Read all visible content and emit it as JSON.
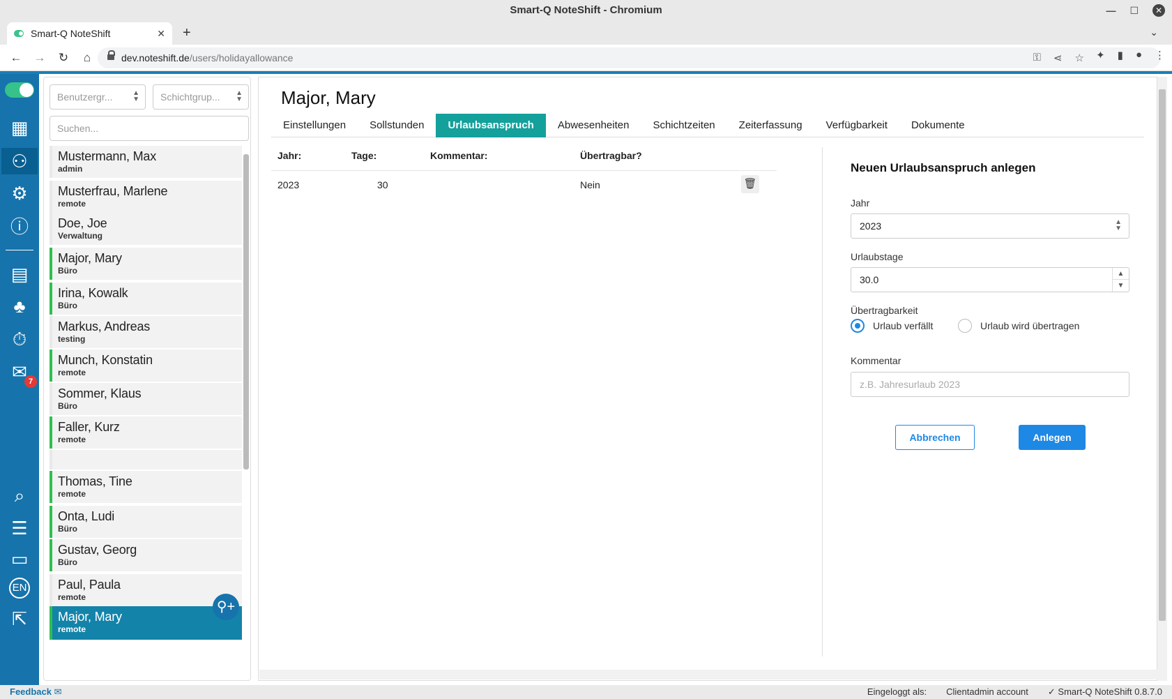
{
  "browser": {
    "window_title": "Smart-Q NoteShift - Chromium",
    "tab_title": "Smart-Q NoteShift",
    "url_host": "dev.noteshift.de",
    "url_path": "/users/holidayallowance"
  },
  "filters": {
    "user_group_placeholder": "Benutzergr...",
    "shift_group_placeholder": "Schichtgrup...",
    "search_placeholder": "Suchen..."
  },
  "users": [
    {
      "name": "Mustermann, Max",
      "group": "admin"
    },
    {
      "name": "Musterfrau, Marlene",
      "group": "remote"
    },
    {
      "name": "Doe, Joe",
      "group": "Verwaltung"
    },
    {
      "name": "Major, Mary",
      "group": "Büro"
    },
    {
      "name": "Irina, Kowalk",
      "group": "Büro"
    },
    {
      "name": "Markus, Andreas",
      "group": "testing"
    },
    {
      "name": "Munch, Konstatin",
      "group": "remote"
    },
    {
      "name": "Sommer, Klaus",
      "group": "Büro"
    },
    {
      "name": "Faller, Kurz",
      "group": "remote"
    },
    {
      "name": "",
      "group": ""
    },
    {
      "name": "Thomas, Tine",
      "group": "remote"
    },
    {
      "name": "Onta, Ludi",
      "group": "Büro"
    },
    {
      "name": "Gustav, Georg",
      "group": "Büro"
    },
    {
      "name": "Paul, Paula",
      "group": "remote"
    },
    {
      "name": "Major, Mary",
      "group": "remote"
    }
  ],
  "mail_badge": "7",
  "page": {
    "title": "Major, Mary",
    "tabs": [
      "Einstellungen",
      "Sollstunden",
      "Urlaubsanspruch",
      "Abwesenheiten",
      "Schichtzeiten",
      "Zeiterfassung",
      "Verfügbarkeit",
      "Dokumente"
    ],
    "active_tab": "Urlaubsanspruch"
  },
  "allowance_table": {
    "headers": {
      "year": "Jahr:",
      "days": "Tage:",
      "comment": "Kommentar:",
      "transferable": "Übertragbar?"
    },
    "rows": [
      {
        "year": "2023",
        "days": "30",
        "comment": "",
        "transferable": "Nein"
      }
    ]
  },
  "form": {
    "heading": "Neuen Urlaubsanspruch anlegen",
    "year_label": "Jahr",
    "year_value": "2023",
    "days_label": "Urlaubstage",
    "days_value": "30.0",
    "transfer_label": "Übertragbarkeit",
    "option_expires": "Urlaub verfällt",
    "option_transferred": "Urlaub wird übertragen",
    "selected_option": "Urlaub verfällt",
    "comment_label": "Kommentar",
    "comment_placeholder": "z.B. Jahresurlaub 2023",
    "cancel_label": "Abbrechen",
    "submit_label": "Anlegen"
  },
  "footer": {
    "feedback": "Feedback",
    "logged_in_label": "Eingeloggt als:",
    "account": "Clientadmin account",
    "version": "Smart-Q NoteShift 0.8.7.0"
  },
  "colors": {
    "nav_blue": "#1773ab",
    "active_tab": "#14a09b",
    "selected_user": "#1483a9",
    "user_bar_green": "#2fbf4f",
    "primary_button": "#1e88e5"
  }
}
